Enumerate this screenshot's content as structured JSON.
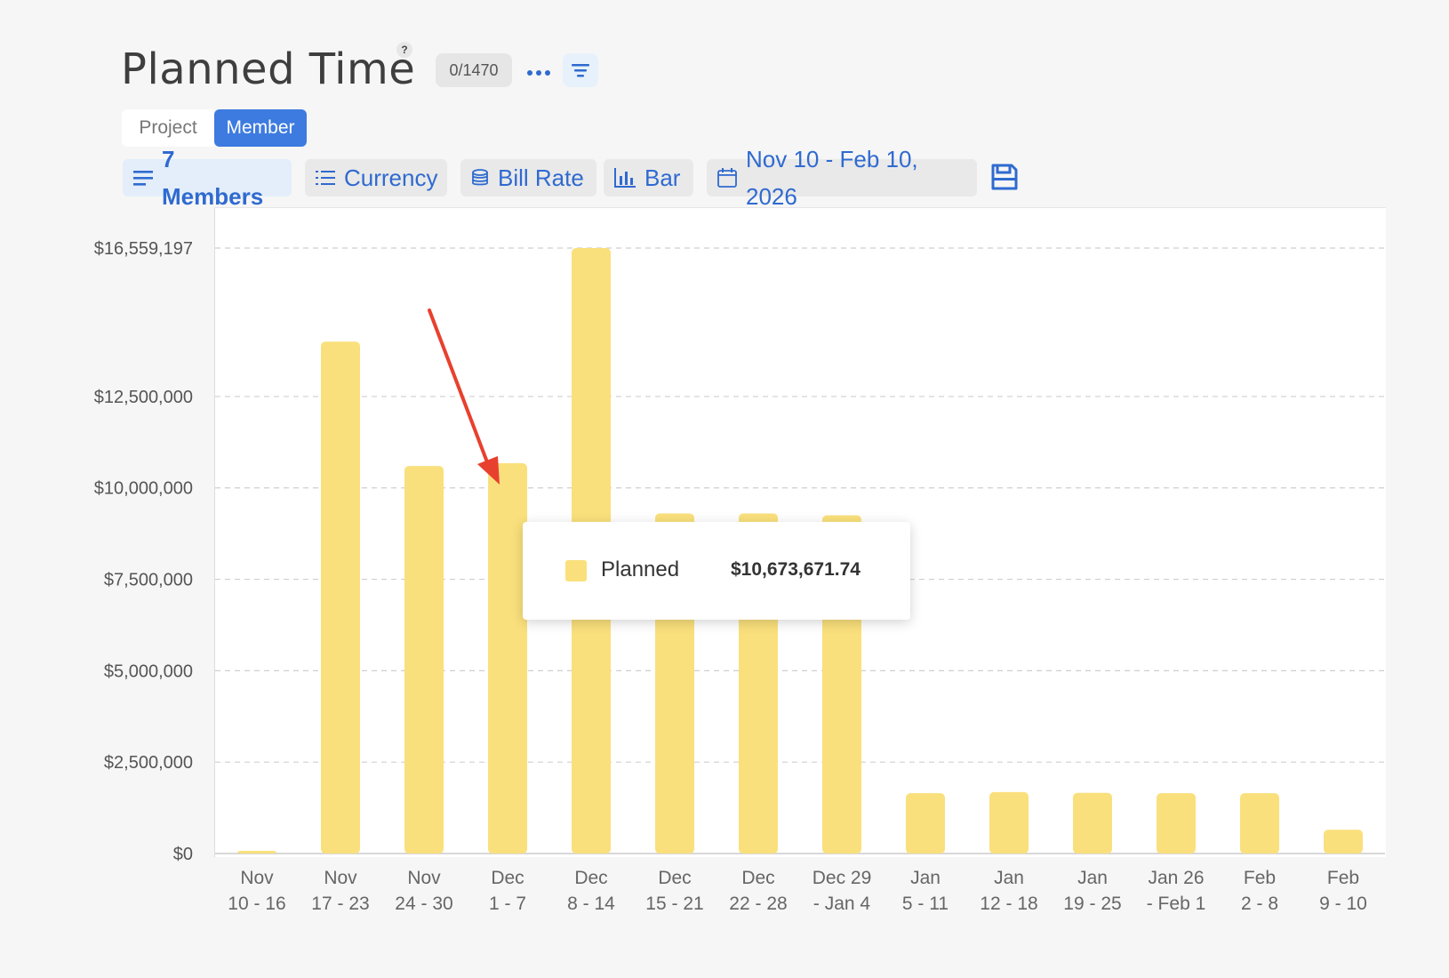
{
  "header": {
    "title": "Planned Time",
    "help": "?",
    "count": "0/1470",
    "more_icon": "more-dots-icon",
    "filter_icon": "filter-icon"
  },
  "view_toggle": {
    "project": "Project",
    "member": "Member",
    "active": "Member"
  },
  "toolbar": {
    "members": "7 Members",
    "currency": "Currency",
    "bill_rate": "Bill Rate",
    "chart_type": "Bar",
    "date_range": "Nov 10 - Feb 10, 2026"
  },
  "colors": {
    "bar": "#fae07c",
    "accent": "#3d7be0",
    "link": "#2f6ad0",
    "arrow": "#e8402e"
  },
  "tooltip": {
    "label": "Planned",
    "value": "$10,673,671.74"
  },
  "chart_data": {
    "type": "bar",
    "categories": [
      [
        "Nov",
        "10 - 16"
      ],
      [
        "Nov",
        "17 - 23"
      ],
      [
        "Nov",
        "24 - 30"
      ],
      [
        "Dec",
        "1 - 7"
      ],
      [
        "Dec",
        "8 - 14"
      ],
      [
        "Dec",
        "15 - 21"
      ],
      [
        "Dec",
        "22 - 28"
      ],
      [
        "Dec 29",
        "- Jan 4"
      ],
      [
        "Jan",
        "5 - 11"
      ],
      [
        "Jan",
        "12 - 18"
      ],
      [
        "Jan",
        "19 - 25"
      ],
      [
        "Jan 26",
        "- Feb 1"
      ],
      [
        "Feb",
        "2 - 8"
      ],
      [
        "Feb",
        "9 - 10"
      ]
    ],
    "series": [
      {
        "name": "Planned",
        "values": [
          60000,
          14000000,
          10600000,
          10673671.74,
          16559197,
          9300000,
          9300000,
          9250000,
          1650000,
          1680000,
          1660000,
          1650000,
          1650000,
          650000
        ]
      }
    ],
    "ylim": [
      0,
      16559197
    ],
    "yticks": [
      0,
      2500000,
      5000000,
      7500000,
      10000000,
      12500000,
      16559197
    ],
    "ytick_labels": [
      "$0",
      "$2,500,000",
      "$5,000,000",
      "$7,500,000",
      "$10,000,000",
      "$12,500,000",
      "$16,559,197"
    ],
    "grid": true,
    "highlighted_category": "Dec 1 - 7"
  }
}
